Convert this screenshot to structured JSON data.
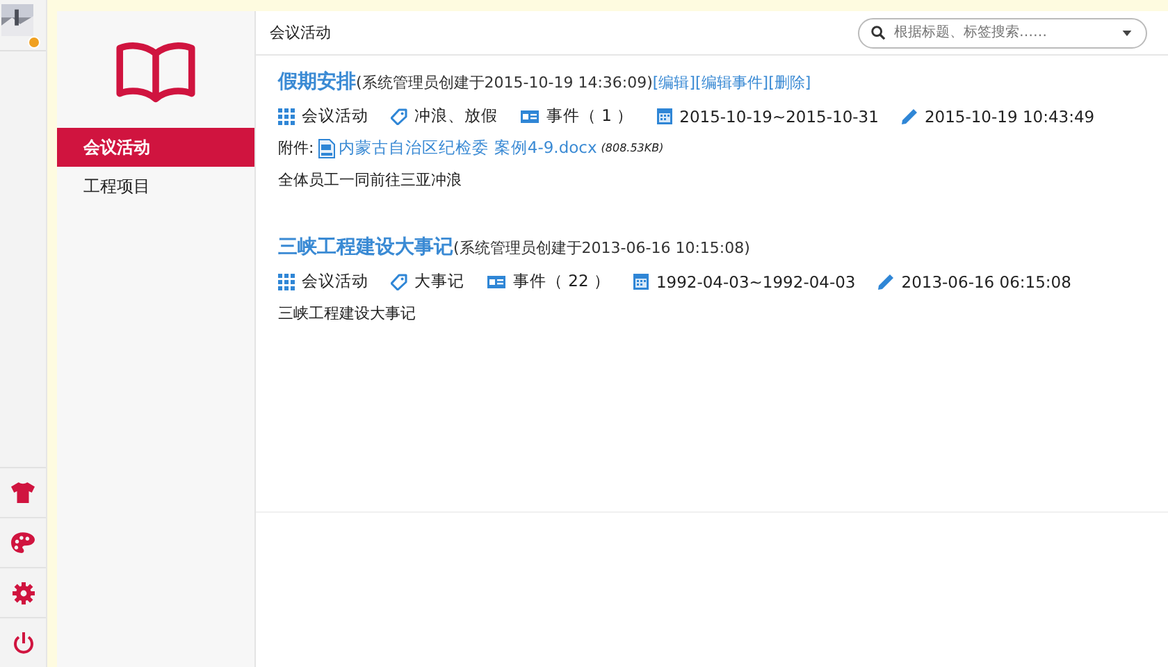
{
  "nav": {
    "items": [
      {
        "label": "会议活动",
        "selected": true
      },
      {
        "label": "工程项目",
        "selected": false
      }
    ]
  },
  "header": {
    "title": "会议活动",
    "search": {
      "placeholder": "根据标题、标签搜索……"
    }
  },
  "events": [
    {
      "title": "假期安排",
      "created": "(系统管理员创建于2015-10-19 14:36:09)",
      "actions": [
        "[编辑]",
        "[编辑事件]",
        "[删除]"
      ],
      "category": "会议活动",
      "tags": "冲浪、放假",
      "event_count": "事件（ 1 ）",
      "range": "2015-10-19~2015-10-31",
      "modified": "2015-10-19 10:43:49",
      "attachment": {
        "label": "附件:",
        "file": "内蒙古自治区纪检委 案例4-9.docx",
        "size": "(808.53KB)"
      },
      "description": "全体员工一同前往三亚冲浪"
    },
    {
      "title": "三峡工程建设大事记",
      "created": "(系统管理员创建于2013-06-16 10:15:08)",
      "category": "会议活动",
      "tags": "大事记",
      "event_count": "事件（ 22 ）",
      "range": "1992-04-03~1992-04-03",
      "modified": "2013-06-16 06:15:08",
      "description": "三峡工程建设大事记"
    }
  ]
}
